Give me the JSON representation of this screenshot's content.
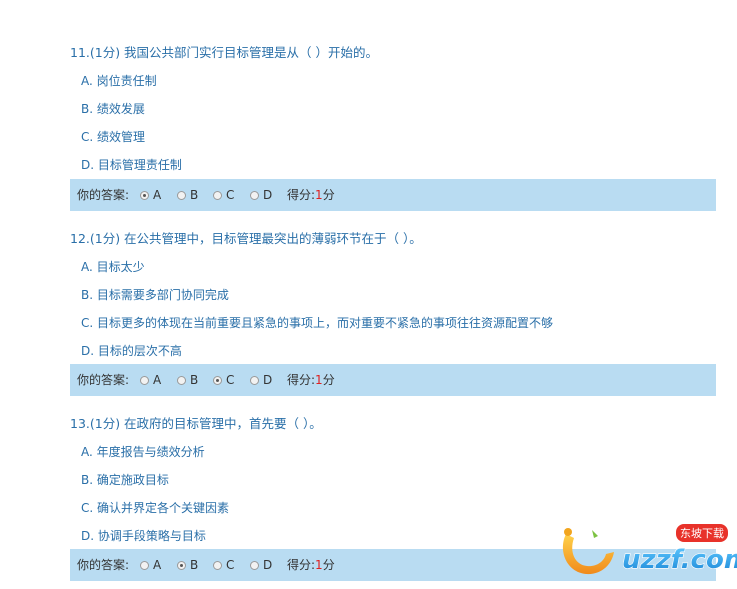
{
  "questions": [
    {
      "title": "11.(1分) 我国公共部门实行目标管理是从（  ）开始的。",
      "options": [
        "A. 岗位责任制",
        "B. 绩效发展",
        "C. 绩效管理",
        "D. 目标管理责任制"
      ],
      "answer_label": "你的答案:",
      "choices": [
        "A",
        "B",
        "C",
        "D"
      ],
      "selected": "A",
      "score_label": "得分:",
      "score_value": "1",
      "score_unit": "分"
    },
    {
      "title": "12.(1分) 在公共管理中，目标管理最突出的薄弱环节在于（  ）。",
      "options": [
        "A. 目标太少",
        "B. 目标需要多部门协同完成",
        "C. 目标更多的体现在当前重要且紧急的事项上，而对重要不紧急的事项往往资源配置不够",
        "D. 目标的层次不高"
      ],
      "answer_label": "你的答案:",
      "choices": [
        "A",
        "B",
        "C",
        "D"
      ],
      "selected": "C",
      "score_label": "得分:",
      "score_value": "1",
      "score_unit": "分"
    },
    {
      "title": "13.(1分) 在政府的目标管理中，首先要（  ）。",
      "options": [
        "A. 年度报告与绩效分析",
        "B. 确定施政目标",
        "C. 确认并界定各个关键因素",
        "D. 协调手段策略与目标"
      ],
      "answer_label": "你的答案:",
      "choices": [
        "A",
        "B",
        "C",
        "D"
      ],
      "selected": "B",
      "score_label": "得分:",
      "score_value": "1",
      "score_unit": "分"
    }
  ],
  "watermark": {
    "brand": "uzzf.com",
    "badge": "东坡下载"
  },
  "colors": {
    "question_text": "#2a6fa8",
    "answer_bar": "#b9dcf2",
    "score_point": "#e02020"
  }
}
